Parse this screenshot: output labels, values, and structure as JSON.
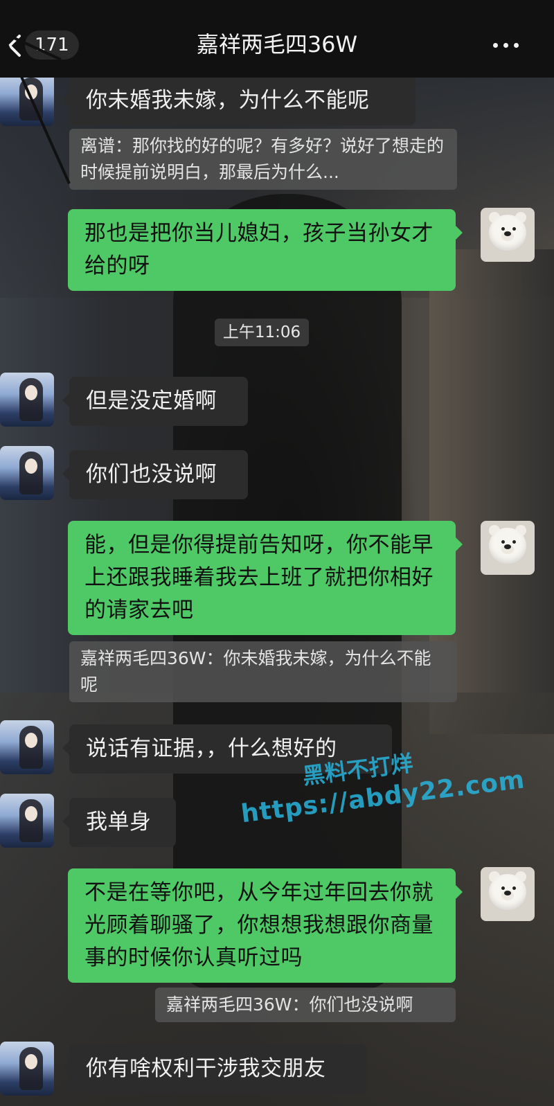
{
  "header": {
    "back_count": "171",
    "title": "嘉祥两毛四36W"
  },
  "timestamp": "上午11:06",
  "messages": {
    "m1": "你未婚我未嫁，为什么不能呢",
    "q1": "离谱：那你找的好的呢？有多好？说好了想走的时候提前说明白，那最后为什么...",
    "m2": "那也是把你当儿媳妇，孩子当孙女才给的呀",
    "m3": "但是没定婚啊",
    "m4": "你们也没说啊",
    "m5": "能，但是你得提前告知呀，你不能早上还跟我睡着我去上班了就把你相好的请家去吧",
    "q2": "嘉祥两毛四36W：你未婚我未嫁，为什么不能呢",
    "m6": "说话有证据，，什么想好的",
    "m7": "我单身",
    "m8": "不是在等你吧，从今年过年回去你就光顾着聊骚了，你想想我想跟你商量事的时候你认真听过吗",
    "q3": "嘉祥两毛四36W：你们也没说啊",
    "m9": "你有啥权利干涉我交朋友"
  },
  "watermark": {
    "line1": "黑料不打烊",
    "line2": "https://abdy22.com"
  },
  "colors": {
    "outgoing_bubble": "#4fc866",
    "incoming_bubble": "#2c2c2c",
    "header_bg": "#111111"
  },
  "icons": {
    "back": "chevron-left-icon",
    "more": "more-dots-icon"
  }
}
